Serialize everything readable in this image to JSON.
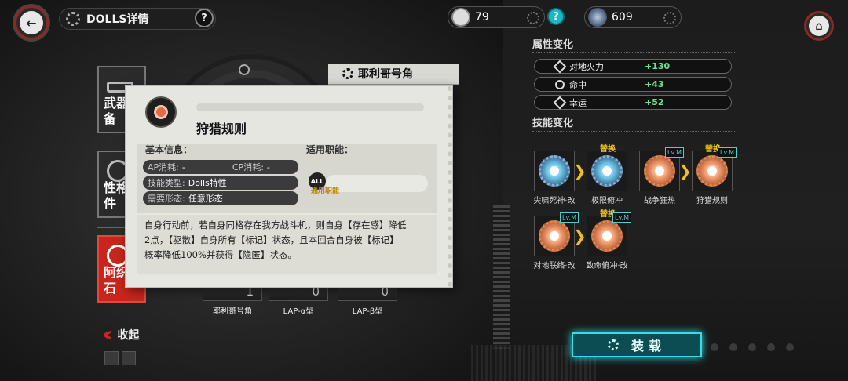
{
  "header": {
    "title": "DOLLS详情",
    "help": "?",
    "resources": [
      {
        "icon": "ammo-icon",
        "value": "79"
      },
      {
        "icon": "crystal-icon",
        "value": "609"
      }
    ],
    "info": "?"
  },
  "sidebar": {
    "tabs": [
      {
        "label": "武器装备",
        "icon": "gun-icon"
      },
      {
        "label": "性格插件",
        "icon": "plugin-icon"
      },
      {
        "label": "阿织班石",
        "icon": "skill-icon"
      }
    ],
    "collapse_label": "收起"
  },
  "weapon": {
    "name": "耶利哥号角",
    "slots": [
      {
        "label": "耶利哥号角",
        "count": "1"
      },
      {
        "label": "LAP-α型",
        "count": "0"
      },
      {
        "label": "LAP-β型",
        "count": "0"
      }
    ]
  },
  "popup": {
    "skill_name": "狩猎规则",
    "basic_info_title": "基本信息：",
    "job_title": "适用职能：",
    "ap_label": "AP消耗:",
    "ap_value": "-",
    "cp_label": "CP消耗:",
    "cp_value": "-",
    "type_label": "技能类型:",
    "type_value": "Dolls特性",
    "form_label": "需要形态:",
    "form_value": "任意形态",
    "job_icon_text": "ALL",
    "job_label": "通用职能",
    "description_lines": [
      "自身行动前，若自身同格存在我方战斗机，则自身【存在感】降低",
      "2点，【驱散】自身所有【标记】状态，且本回合自身被【标记】",
      "概率降低100%并获得【隐匿】状态。"
    ]
  },
  "attributes": {
    "title": "属性变化",
    "rows": [
      {
        "name": "对地火力",
        "value": "+130"
      },
      {
        "name": "命中",
        "value": "+43"
      },
      {
        "name": "幸运",
        "value": "+52"
      }
    ]
  },
  "skills": {
    "title": "技能变化",
    "swap_label": "替换",
    "lv_label": "Lv.M",
    "items": [
      {
        "name": "尖啸死神·改"
      },
      {
        "name": "极限俯冲"
      },
      {
        "name": "战争狂热"
      },
      {
        "name": "狩猎规则"
      },
      {
        "name": "对地联络·改"
      },
      {
        "name": "致命俯冲·改"
      }
    ]
  },
  "equip_button": "装载"
}
